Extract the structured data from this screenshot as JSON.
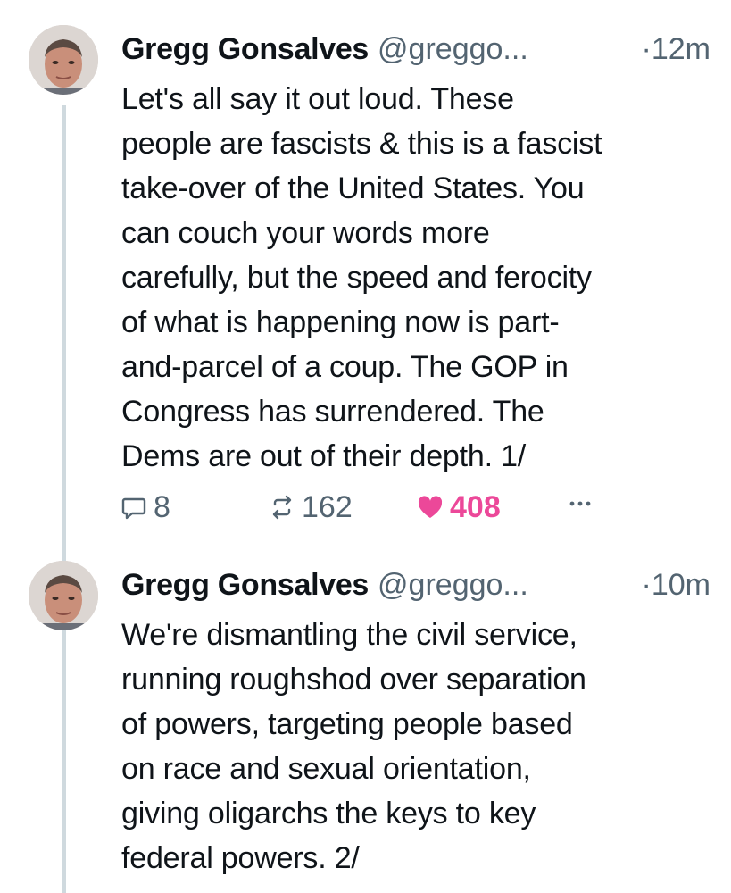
{
  "posts": [
    {
      "author_name": "Gregg Gonsalves",
      "handle": "@greggo...",
      "time": "·12m",
      "lines": [
        "Let's all say it out loud. These",
        "people are fascists & this is a fascist",
        "take-over of the United States. You",
        "can couch your words more",
        "carefully, but the speed and ferocity",
        "of what is happening now is part-",
        "and-parcel of a coup. The GOP in",
        "Congress has surrendered. The",
        "Dems are out of their depth. 1/"
      ],
      "replies": "8",
      "reposts": "162",
      "likes": "408"
    },
    {
      "author_name": "Gregg Gonsalves",
      "handle": "@greggo...",
      "time": "·10m",
      "lines": [
        "We're dismantling the civil service,",
        "running roughshod over separation",
        "of powers, targeting people based",
        "on race and sexual orientation,",
        "giving oligarchs the keys to key",
        "federal powers. 2/"
      ]
    }
  ],
  "colors": {
    "text": "#0f1419",
    "muted": "#536471",
    "like": "#ec4899",
    "thread_line": "#cfd9de"
  },
  "icons": [
    "reply-icon",
    "repost-icon",
    "heart-icon",
    "more-icon"
  ]
}
